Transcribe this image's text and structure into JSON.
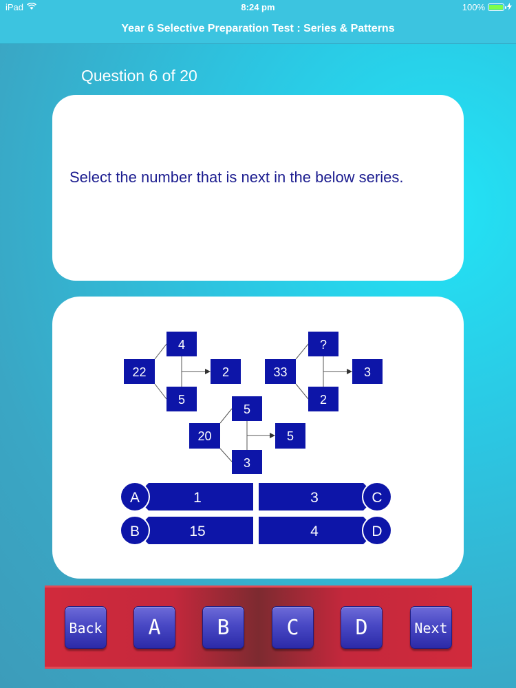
{
  "status_bar": {
    "device": "iPad",
    "time": "8:24 pm",
    "battery": "100%",
    "battery_level": 1.0
  },
  "nav_bar": {
    "title": "Year 6 Selective Preparation Test : Series & Patterns"
  },
  "question": {
    "counter": "Question 6 of 20",
    "text": "Select the number that is next in the below series."
  },
  "diagram": {
    "groups": [
      {
        "left": "22",
        "top": "4",
        "bottom": "5",
        "right": "2"
      },
      {
        "left": "33",
        "top": "?",
        "bottom": "2",
        "right": "3"
      },
      {
        "left": "20",
        "top": "5",
        "bottom": "3",
        "right": "5"
      }
    ]
  },
  "options": [
    {
      "letter": "A",
      "value": "1"
    },
    {
      "letter": "B",
      "value": "15"
    },
    {
      "letter": "C",
      "value": "3"
    },
    {
      "letter": "D",
      "value": "4"
    }
  ],
  "toolbar": {
    "back_label": "Back",
    "a_label": "A",
    "b_label": "B",
    "c_label": "C",
    "d_label": "D",
    "next_label": "Next"
  },
  "colors": {
    "accent": "#0d15a8",
    "question_text": "#1b1c8f",
    "toolbar_red": "#c4283c",
    "toolbar_button": "#4848c4"
  }
}
